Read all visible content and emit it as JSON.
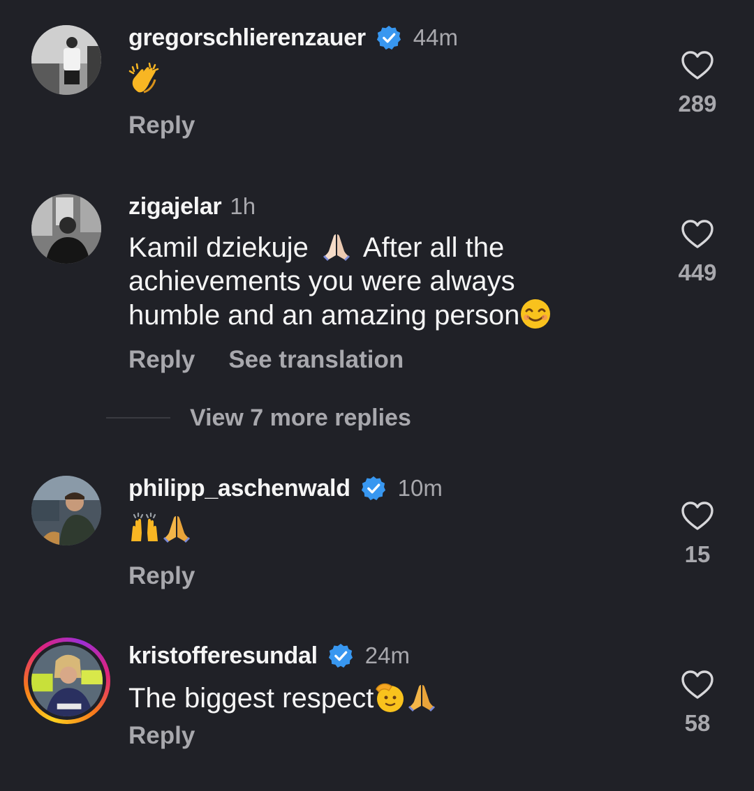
{
  "comments": [
    {
      "username": "gregorschlierenzauer",
      "verified": true,
      "time": "44m",
      "text": "",
      "emoji": [
        "clapping-hands-icon"
      ],
      "reply": "Reply",
      "likes": "289"
    },
    {
      "username": "zigajelar",
      "verified": false,
      "time": "1h",
      "text_line1": "Kamil dziekuje",
      "text_line1b": " After all the",
      "text_line2": "achievements you were always",
      "text_line3": "humble and an amazing person",
      "reply": "Reply",
      "translate": "See translation",
      "likes": "449"
    },
    {
      "username": "philipp_aschenwald",
      "verified": true,
      "time": "10m",
      "emoji": [
        "raising-hands-icon",
        "folded-hands-icon"
      ],
      "reply": "Reply",
      "likes": "15"
    },
    {
      "username": "kristofferesundal",
      "verified": true,
      "time": "24m",
      "text": "The biggest respect",
      "reply": "Reply",
      "likes": "58"
    }
  ],
  "more_replies": "View 7 more replies",
  "colors": {
    "background": "#202127",
    "secondary": "#a8a8ad",
    "verified": "#3897f0"
  }
}
